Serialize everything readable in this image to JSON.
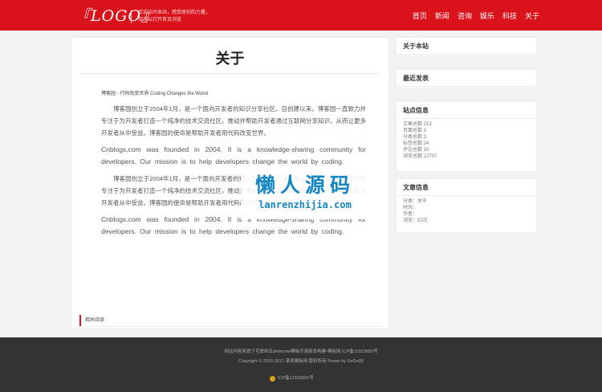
{
  "header": {
    "logo": "『LOGO』",
    "slogan_line1": "欢迎访问本站，感受原创的力量，",
    "slogan_line2": "你可以打开首页浏览",
    "nav": [
      "首页",
      "新闻",
      "咨询",
      "娱乐",
      "科技",
      "关于"
    ]
  },
  "main": {
    "title": "关于",
    "subhead": "博客园 - 代码改变世界 Coding Changes the World",
    "paragraphs": [
      {
        "lang": "cn",
        "text": "博客园创立于2004年1月，是一个面向开发者的知识分享社区。自创建以来，博客园一直致力并专注于为开发者打造一个纯净的技术交流社区，推动并帮助开发者通过互联网分享知识，从而让更多开发者从中受益。博客园的使命是帮助开发者用代码改变世界。"
      },
      {
        "lang": "en",
        "text": "Cnblogs.com was founded in 2004. It is a knowledge-sharing community for developers. Our mission is to help developers change the world by coding."
      },
      {
        "lang": "cn",
        "text": "博客园创立于2004年1月，是一个面向开发者的知识分享社区。自创建以来，博客园一直致力并专注于为开发者打造一个纯净的技术交流社区，推动并帮助开发者通过互联网分享知识，从而让更多开发者从中受益。博客园的使命是帮助开发者用代码改变世界。"
      },
      {
        "lang": "en",
        "text": "Cnblogs.com was founded in 2004. It is a knowledge-sharing community for developers. Our mission is to help developers change the world by coding."
      }
    ],
    "related": "相关阅读"
  },
  "watermark": {
    "cn": "懒人源码",
    "en": "lanrenzhijia.com"
  },
  "sidebar": {
    "about": {
      "title": "关于本站"
    },
    "recent": {
      "title": "最近发表"
    },
    "site_info": {
      "title": "站点信息",
      "lines": [
        "文章总数:213",
        "页面总数:3",
        "分类总数:3",
        "标签总数:24",
        "评论总数:10",
        "浏览总数:12707"
      ]
    },
    "article_info": {
      "title": "文章信息",
      "lines": [
        "分类：关于",
        "时间：",
        "作者：",
        "浏览：53次"
      ]
    }
  },
  "footer": {
    "line1": "网站内容来源于互联网及dedecms模板开源版本构建-模板网 ICP备12323655号",
    "line2": "Copyright © 2002-2017 某某模板网 版权所有 Power by DeDe58",
    "icp": "ICP备12323655号"
  }
}
